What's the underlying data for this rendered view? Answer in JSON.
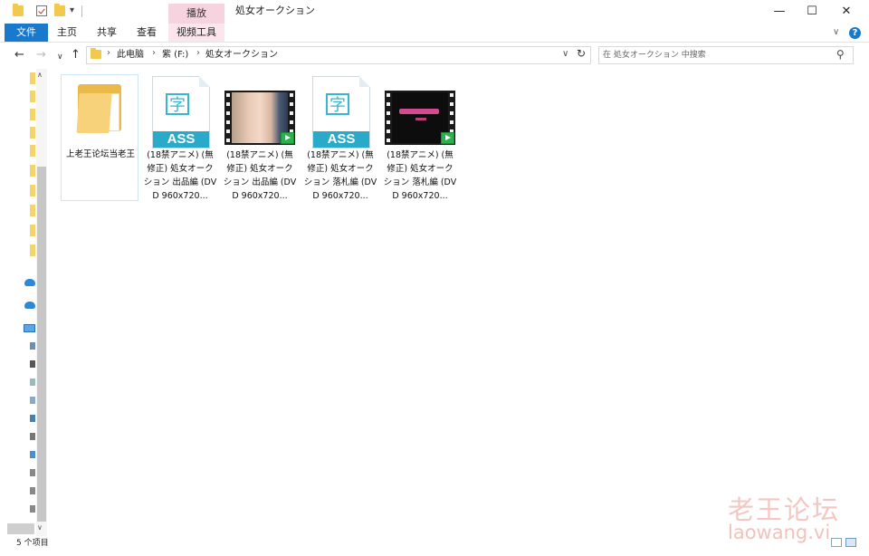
{
  "window": {
    "title": "処女オークション",
    "minimize_glyph": "—",
    "maximize_glyph": "☐",
    "close_glyph": "✕"
  },
  "quick_access": {
    "icons": [
      "folder-icon",
      "properties-icon",
      "new-folder-icon"
    ],
    "customize_glyph": "▾"
  },
  "ribbon": {
    "context_group_label": "播放",
    "tabs": [
      "文件",
      "主页",
      "共享",
      "查看",
      "视频工具"
    ],
    "collapse_glyph": "∨",
    "help_glyph": "?"
  },
  "addressbar": {
    "back_glyph": "←",
    "forward_glyph": "→",
    "recent_glyph": "∨",
    "up_glyph": "↑",
    "breadcrumbs": [
      "此电脑",
      "紫 (F:)",
      "処女オークション"
    ],
    "separator": "›",
    "dropdown_glyph": "∨",
    "refresh_glyph": "↻"
  },
  "search": {
    "placeholder": "在 処女オークション 中搜索",
    "icon": "search-icon"
  },
  "files": [
    {
      "type": "folder",
      "name": "上老王论坛当老王",
      "selected": true
    },
    {
      "type": "subtitle",
      "badge": "ASS",
      "glyph": "字",
      "name": "(18禁アニメ) (無修正) 処女オークション 出品編 (DVD 960x720..."
    },
    {
      "type": "video",
      "name": "(18禁アニメ) (無修正) 処女オークション 出品編 (DVD 960x720..."
    },
    {
      "type": "subtitle",
      "badge": "ASS",
      "glyph": "字",
      "name": "(18禁アニメ) (無修正) 処女オークション 落札編 (DVD 960x720..."
    },
    {
      "type": "video",
      "name": "(18禁アニメ) (無修正) 処女オークション 落札編 (DVD 960x720..."
    }
  ],
  "statusbar": {
    "count_text": "5 个项目"
  },
  "watermark": {
    "cn": "老王论坛",
    "en": "laowang.vi"
  },
  "colors": {
    "accent": "#1979ca",
    "context_tab": "#f6d3df",
    "folder": "#f7d27a",
    "ass_band": "#2aa9c9",
    "play_badge": "#2bb24c"
  },
  "nav_scroll_up_glyph": "∧",
  "nav_scroll_down_glyph": "∨"
}
